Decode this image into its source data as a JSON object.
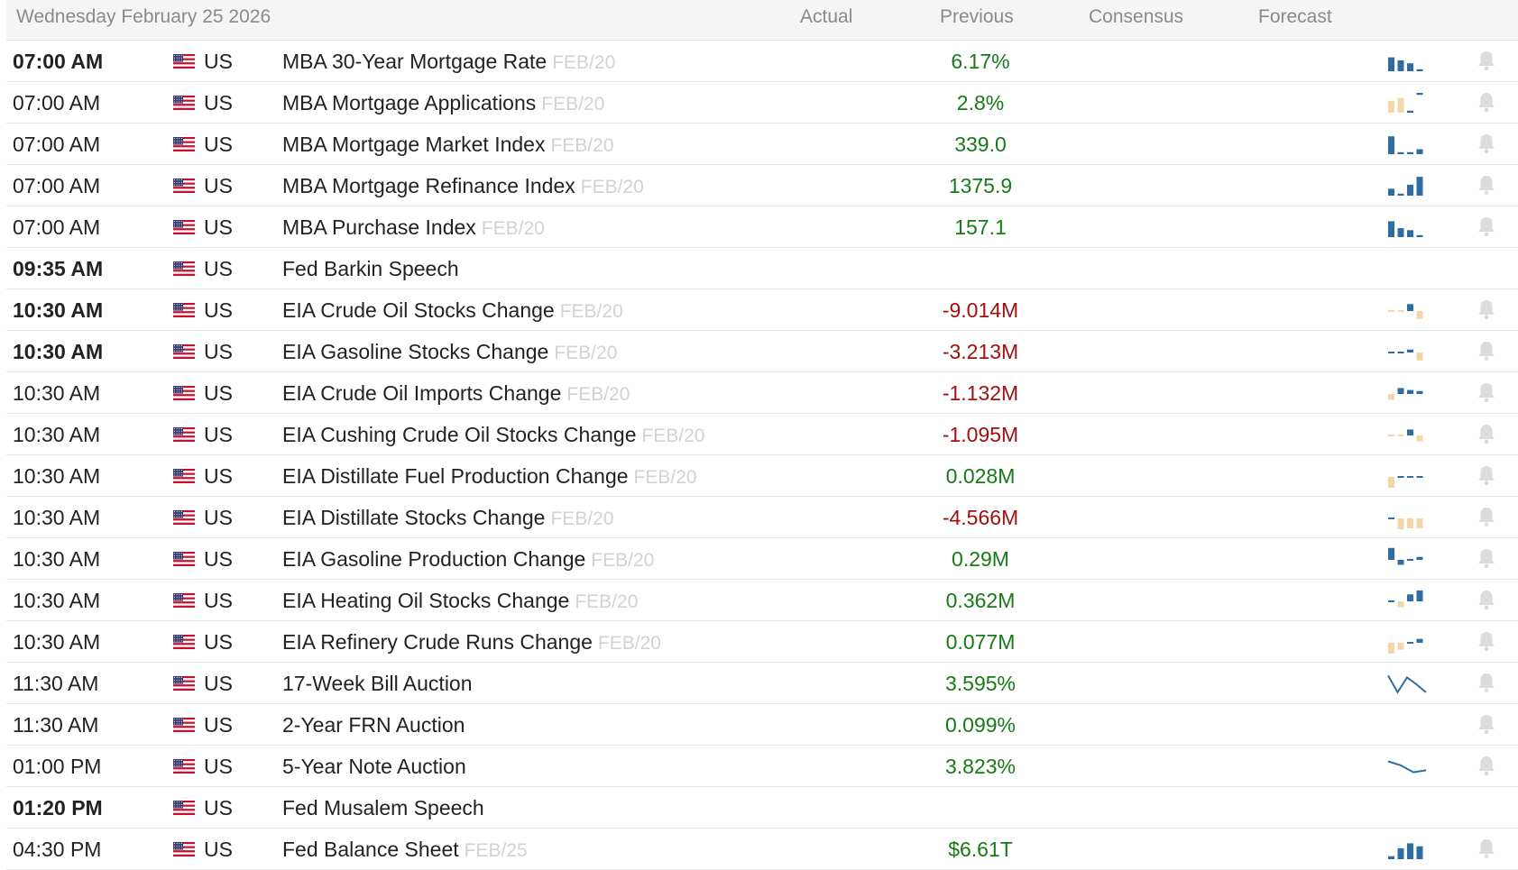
{
  "header": {
    "date": "Wednesday February 25 2026",
    "actual": "Actual",
    "previous": "Previous",
    "consensus": "Consensus",
    "forecast": "Forecast"
  },
  "colors": {
    "positive": "#177a17",
    "negative": "#a20f0f",
    "spark_blue": "#2e6da4",
    "spark_beige": "#f4d7a6",
    "bell": "#dcdcdc"
  },
  "rows": [
    {
      "time": "07:00 AM",
      "bold": true,
      "country": "US",
      "event": "MBA 30-Year Mortgage Rate",
      "ref": "FEB/20",
      "previous": "6.17%",
      "sign": "pos",
      "spark": "bars",
      "bars": [
        {
          "h": 0.7,
          "c": "blue"
        },
        {
          "h": 0.55,
          "c": "blue"
        },
        {
          "h": 0.4,
          "c": "blue"
        },
        {
          "h": 0.1,
          "c": "blue"
        }
      ],
      "bell": true
    },
    {
      "time": "07:00 AM",
      "bold": false,
      "country": "US",
      "event": "MBA Mortgage Applications",
      "ref": "FEB/20",
      "previous": "2.8%",
      "sign": "pos",
      "spark": "bars",
      "bars": [
        {
          "h": 0.6,
          "c": "beige"
        },
        {
          "h": 0.75,
          "c": "beige"
        },
        {
          "h": 0.1,
          "c": "blue"
        },
        {
          "h": 0.25,
          "c": "blue",
          "top": true
        }
      ],
      "bell": true
    },
    {
      "time": "07:00 AM",
      "bold": false,
      "country": "US",
      "event": "MBA Mortgage Market Index",
      "ref": "FEB/20",
      "previous": "339.0",
      "sign": "pos",
      "spark": "bars",
      "bars": [
        {
          "h": 0.9,
          "c": "blue"
        },
        {
          "h": 0.1,
          "c": "blue"
        },
        {
          "h": 0.1,
          "c": "blue"
        },
        {
          "h": 0.25,
          "c": "blue"
        }
      ],
      "bell": true
    },
    {
      "time": "07:00 AM",
      "bold": false,
      "country": "US",
      "event": "MBA Mortgage Refinance Index",
      "ref": "FEB/20",
      "previous": "1375.9",
      "sign": "pos",
      "spark": "bars",
      "bars": [
        {
          "h": 0.35,
          "c": "blue"
        },
        {
          "h": 0.1,
          "c": "blue"
        },
        {
          "h": 0.55,
          "c": "blue"
        },
        {
          "h": 0.95,
          "c": "blue"
        }
      ],
      "bell": true
    },
    {
      "time": "07:00 AM",
      "bold": false,
      "country": "US",
      "event": "MBA Purchase Index",
      "ref": "FEB/20",
      "previous": "157.1",
      "sign": "pos",
      "spark": "bars",
      "bars": [
        {
          "h": 0.8,
          "c": "blue"
        },
        {
          "h": 0.45,
          "c": "blue"
        },
        {
          "h": 0.35,
          "c": "blue"
        },
        {
          "h": 0.1,
          "c": "blue"
        }
      ],
      "bell": true
    },
    {
      "time": "09:35 AM",
      "bold": true,
      "country": "US",
      "event": "Fed Barkin Speech",
      "ref": "",
      "previous": "",
      "sign": "pos",
      "spark": "none",
      "bars": [],
      "bell": false
    },
    {
      "time": "10:30 AM",
      "bold": true,
      "country": "US",
      "event": "EIA Crude Oil Stocks Change",
      "ref": "FEB/20",
      "previous": "-9.014M",
      "sign": "neg",
      "spark": "bars",
      "bars": [
        {
          "h": 0.1,
          "c": "beige",
          "mid": true
        },
        {
          "h": 0.1,
          "c": "beige",
          "mid": true
        },
        {
          "h": 0.35,
          "c": "blue",
          "up": true
        },
        {
          "h": 0.4,
          "c": "beige",
          "down": true
        }
      ],
      "bell": true
    },
    {
      "time": "10:30 AM",
      "bold": true,
      "country": "US",
      "event": "EIA Gasoline Stocks Change",
      "ref": "FEB/20",
      "previous": "-3.213M",
      "sign": "neg",
      "spark": "bars",
      "bars": [
        {
          "h": 0.1,
          "c": "blue",
          "mid": true
        },
        {
          "h": 0.1,
          "c": "blue",
          "mid": true
        },
        {
          "h": 0.15,
          "c": "blue",
          "up": true
        },
        {
          "h": 0.4,
          "c": "beige",
          "down": true
        }
      ],
      "bell": true
    },
    {
      "time": "10:30 AM",
      "bold": false,
      "country": "US",
      "event": "EIA Crude Oil Imports Change",
      "ref": "FEB/20",
      "previous": "-1.132M",
      "sign": "neg",
      "spark": "bars",
      "bars": [
        {
          "h": 0.3,
          "c": "beige",
          "down": true
        },
        {
          "h": 0.3,
          "c": "blue",
          "up": true
        },
        {
          "h": 0.2,
          "c": "blue",
          "up": true
        },
        {
          "h": 0.15,
          "c": "blue",
          "up": true
        }
      ],
      "bell": true
    },
    {
      "time": "10:30 AM",
      "bold": false,
      "country": "US",
      "event": "EIA Cushing Crude Oil Stocks Change",
      "ref": "FEB/20",
      "previous": "-1.095M",
      "sign": "neg",
      "spark": "bars",
      "bars": [
        {
          "h": 0.08,
          "c": "beige",
          "mid": true
        },
        {
          "h": 0.08,
          "c": "beige",
          "mid": true
        },
        {
          "h": 0.3,
          "c": "blue",
          "up": true
        },
        {
          "h": 0.3,
          "c": "beige",
          "down": true
        }
      ],
      "bell": true
    },
    {
      "time": "10:30 AM",
      "bold": false,
      "country": "US",
      "event": "EIA Distillate Fuel Production Change",
      "ref": "FEB/20",
      "previous": "0.028M",
      "sign": "pos",
      "spark": "bars",
      "bars": [
        {
          "h": 0.7,
          "c": "beige",
          "down": true
        },
        {
          "h": 0.05,
          "c": "blue",
          "mid": true
        },
        {
          "h": 0.05,
          "c": "blue",
          "mid": true
        },
        {
          "h": 0.05,
          "c": "blue",
          "mid": true
        }
      ],
      "bell": true
    },
    {
      "time": "10:30 AM",
      "bold": false,
      "country": "US",
      "event": "EIA Distillate Stocks Change",
      "ref": "FEB/20",
      "previous": "-4.566M",
      "sign": "neg",
      "spark": "bars",
      "bars": [
        {
          "h": 0.08,
          "c": "blue",
          "mid": true
        },
        {
          "h": 0.6,
          "c": "beige",
          "down": true
        },
        {
          "h": 0.5,
          "c": "beige",
          "down": true
        },
        {
          "h": 0.5,
          "c": "beige",
          "down": true
        }
      ],
      "bell": true
    },
    {
      "time": "10:30 AM",
      "bold": false,
      "country": "US",
      "event": "EIA Gasoline Production Change",
      "ref": "FEB/20",
      "previous": "0.29M",
      "sign": "pos",
      "spark": "bars",
      "bars": [
        {
          "h": 0.6,
          "c": "blue",
          "up": true
        },
        {
          "h": 0.25,
          "c": "blue",
          "down": true
        },
        {
          "h": 0.08,
          "c": "blue",
          "mid": true
        },
        {
          "h": 0.15,
          "c": "blue",
          "up": true
        }
      ],
      "bell": true
    },
    {
      "time": "10:30 AM",
      "bold": false,
      "country": "US",
      "event": "EIA Heating Oil Stocks Change",
      "ref": "FEB/20",
      "previous": "0.362M",
      "sign": "pos",
      "spark": "bars",
      "bars": [
        {
          "h": 0.06,
          "c": "blue",
          "mid": true
        },
        {
          "h": 0.3,
          "c": "beige",
          "down": true
        },
        {
          "h": 0.35,
          "c": "blue",
          "up": true
        },
        {
          "h": 0.55,
          "c": "blue",
          "up": true
        }
      ],
      "bell": true
    },
    {
      "time": "10:30 AM",
      "bold": false,
      "country": "US",
      "event": "EIA Refinery Crude Runs Change",
      "ref": "FEB/20",
      "previous": "0.077M",
      "sign": "pos",
      "spark": "bars",
      "bars": [
        {
          "h": 0.55,
          "c": "beige",
          "down": true
        },
        {
          "h": 0.35,
          "c": "beige",
          "down": true
        },
        {
          "h": 0.06,
          "c": "blue",
          "mid": true
        },
        {
          "h": 0.2,
          "c": "blue",
          "up": true
        }
      ],
      "bell": true
    },
    {
      "time": "11:30 AM",
      "bold": false,
      "country": "US",
      "event": "17-Week Bill Auction",
      "ref": "",
      "previous": "3.595%",
      "sign": "pos",
      "spark": "line",
      "line": [
        0.1,
        0.95,
        0.2,
        0.55,
        0.95
      ],
      "bell": true
    },
    {
      "time": "11:30 AM",
      "bold": false,
      "country": "US",
      "event": "2-Year FRN Auction",
      "ref": "",
      "previous": "0.099%",
      "sign": "pos",
      "spark": "none",
      "bars": [],
      "bell": true
    },
    {
      "time": "01:00 PM",
      "bold": false,
      "country": "US",
      "event": "5-Year Note Auction",
      "ref": "",
      "previous": "3.823%",
      "sign": "pos",
      "spark": "line",
      "line": [
        0.25,
        0.45,
        0.8,
        0.7
      ],
      "bell": true
    },
    {
      "time": "01:20 PM",
      "bold": true,
      "country": "US",
      "event": "Fed Musalem Speech",
      "ref": "",
      "previous": "",
      "sign": "pos",
      "spark": "none",
      "bars": [],
      "bell": false
    },
    {
      "time": "04:30 PM",
      "bold": false,
      "country": "US",
      "event": "Fed Balance Sheet",
      "ref": "FEB/25",
      "previous": "$6.61T",
      "sign": "pos",
      "spark": "bars",
      "bars": [
        {
          "h": 0.15,
          "c": "blue"
        },
        {
          "h": 0.55,
          "c": "blue"
        },
        {
          "h": 0.8,
          "c": "blue"
        },
        {
          "h": 0.65,
          "c": "blue"
        }
      ],
      "bell": true
    }
  ]
}
